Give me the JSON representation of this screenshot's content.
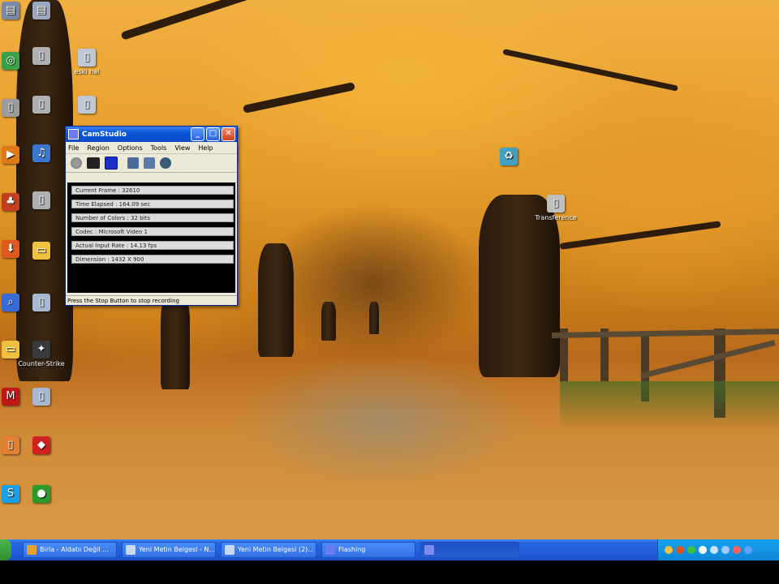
{
  "desktop": {
    "icons": [
      {
        "label": "",
        "icon": "document-icon",
        "color": "#7a8aa8"
      },
      {
        "label": "",
        "icon": "chrome-icon",
        "color": "#3aa04a"
      },
      {
        "label": "",
        "icon": "file-icon",
        "color": "#9c9c9c"
      },
      {
        "label": "",
        "icon": "media-player-icon",
        "color": "#e07a18"
      },
      {
        "label": "",
        "icon": "game-icon",
        "color": "#c04020"
      },
      {
        "label": "",
        "icon": "downloader-icon",
        "color": "#e05a20"
      },
      {
        "label": "",
        "icon": "search-icon",
        "color": "#3a6ad8"
      },
      {
        "label": "",
        "icon": "folder-icon",
        "color": "#f0c040"
      },
      {
        "label": "",
        "icon": "mcafee-icon",
        "color": "#c01818"
      },
      {
        "label": "",
        "icon": "file-icon",
        "color": "#e08030"
      },
      {
        "label": "",
        "icon": "skype-icon",
        "color": "#1aa0e8"
      },
      {
        "label": "",
        "icon": "document-icon",
        "color": "#9aa8c0"
      },
      {
        "label": "",
        "icon": "file-icon",
        "color": "#b0b0b0"
      },
      {
        "label": "",
        "icon": "file-icon",
        "color": "#b0b0b0"
      },
      {
        "label": "",
        "icon": "media-icon",
        "color": "#3a78d0"
      },
      {
        "label": "",
        "icon": "file-icon",
        "color": "#b0b0b0"
      },
      {
        "label": "",
        "icon": "folder-icon",
        "color": "#f0c040"
      },
      {
        "label": "",
        "icon": "file-icon",
        "color": "#a8b8d0"
      },
      {
        "label": "Counter-Strike",
        "icon": "counter-strike-icon",
        "color": "#3a3a3a"
      },
      {
        "label": "",
        "icon": "file-icon",
        "color": "#a8b8d0"
      },
      {
        "label": "",
        "icon": "app-icon",
        "color": "#d02020"
      },
      {
        "label": "",
        "icon": "globe-icon",
        "color": "#2a9a2a"
      },
      {
        "label": "eski hal",
        "icon": "file-icon",
        "color": "#c0c8d8"
      },
      {
        "label": "",
        "icon": "file-icon",
        "color": "#c0c8d8"
      },
      {
        "label": "",
        "icon": "file-icon",
        "color": "#c0c8d8"
      },
      {
        "label": "",
        "icon": "recycle-icon",
        "color": "#40a0c0"
      },
      {
        "label": "Transference",
        "icon": "file-icon",
        "color": "#c0c0c0"
      }
    ]
  },
  "camstudio": {
    "title": "CamStudio",
    "menu": [
      "File",
      "Region",
      "Options",
      "Tools",
      "View",
      "Help"
    ],
    "stats": [
      "Current Frame : 32610",
      "Time Elapsed : 164.09 sec",
      "Number of Colors : 32 bits",
      "Codec : Microsoft Video 1",
      "Actual Input Rate : 14.13 fps",
      "Dimension : 1432 X 900"
    ],
    "status": "Press the Stop Button to stop recording",
    "toolbar_icons": [
      "record-icon",
      "pause-icon",
      "stop-icon",
      "region-icon",
      "annotate-icon",
      "camera-icon"
    ]
  },
  "taskbar": {
    "tasks": [
      "Birla - Aldatıı Değil ...",
      "Yeni Metin Belgesi - N...",
      "Yeni Metin Belgesi (2)...",
      "Flashing",
      ""
    ],
    "clock": ""
  },
  "colors": {
    "taskbar_blue": "#245edb",
    "tray_blue": "#0e86d8",
    "window_face": "#ece9d8",
    "title_blue": "#0b56d8"
  }
}
